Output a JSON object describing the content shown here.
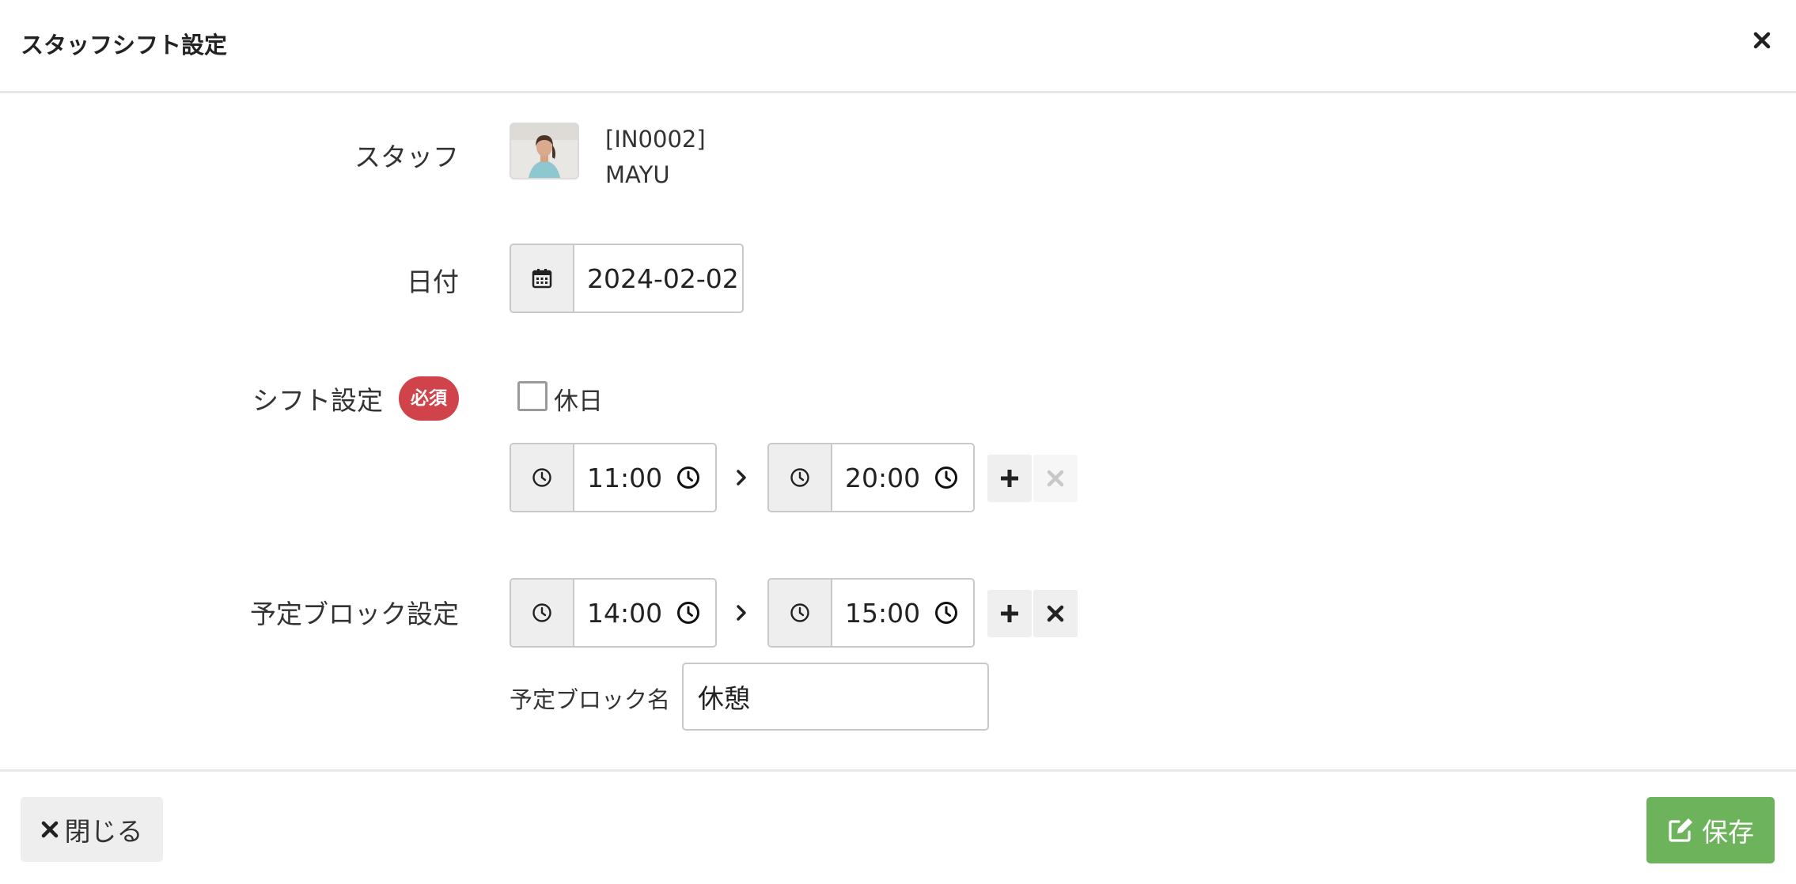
{
  "modal": {
    "title": "スタッフシフト設定"
  },
  "staff": {
    "label": "スタッフ",
    "code": "[IN0002]",
    "name": "MAYU"
  },
  "date": {
    "label": "日付",
    "value": "2024-02-02"
  },
  "shift": {
    "label": "シフト設定",
    "required_badge": "必須",
    "holiday_label": "休日",
    "holiday_checked": false,
    "start": "11:00",
    "end": "20:00"
  },
  "block": {
    "label": "予定ブロック設定",
    "start": "14:00",
    "end": "15:00",
    "name_label": "予定ブロック名",
    "name_value": "休憩"
  },
  "footer": {
    "close_label": "閉じる",
    "save_label": "保存"
  },
  "colors": {
    "required_badge": "#d0434b",
    "save_button": "#6db35b",
    "addon_bg": "#eeeeee"
  },
  "icons": {
    "header_close": "close-icon",
    "date_addon": "calendar-icon",
    "time_addon": "clock-icon",
    "add": "plus-icon",
    "remove": "close-icon",
    "separator": "chevron-right-icon",
    "save": "edit-icon"
  }
}
